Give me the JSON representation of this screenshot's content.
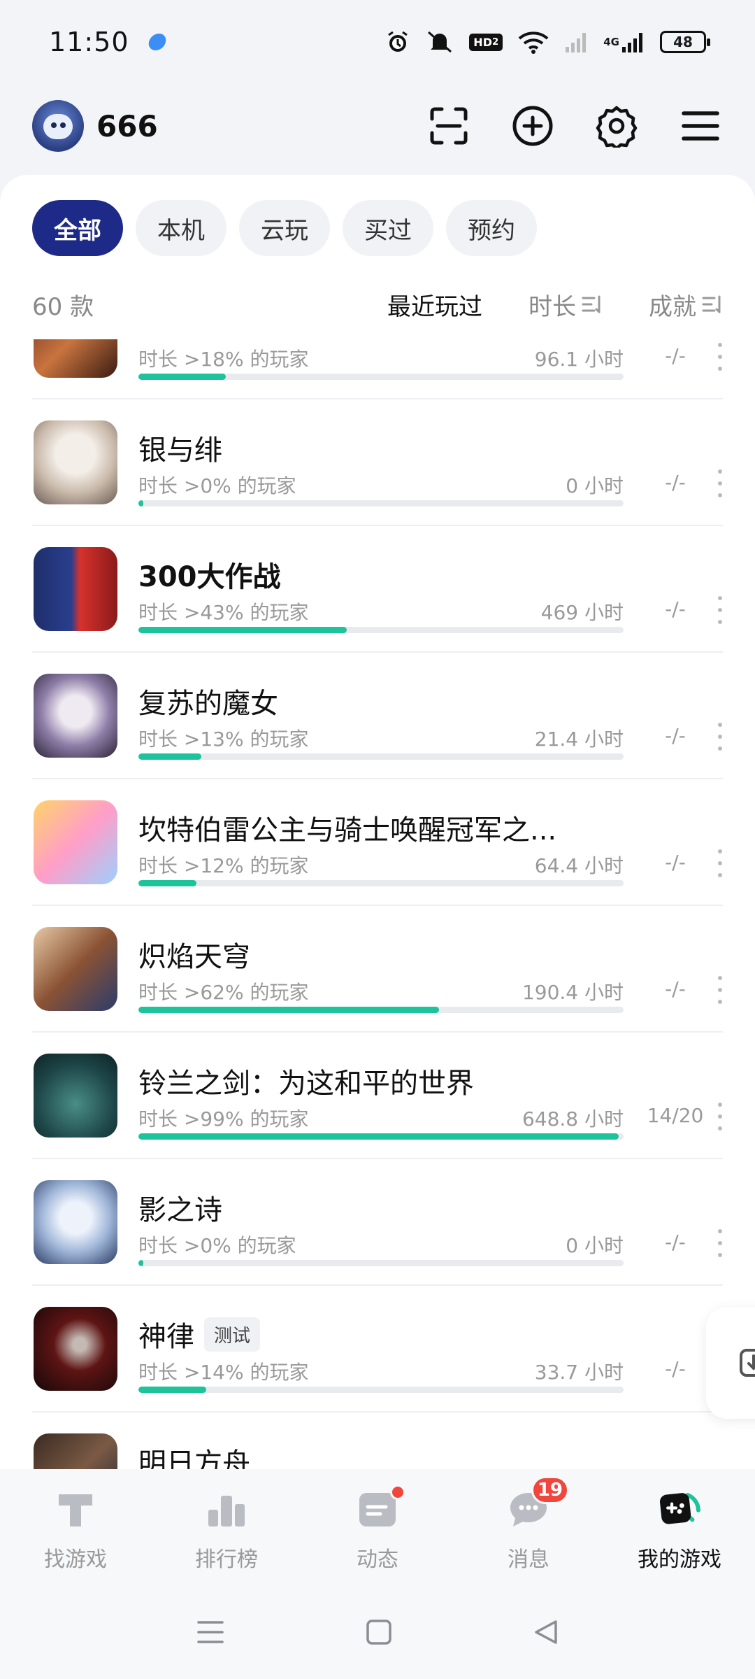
{
  "status": {
    "time": "11:50",
    "network": "4G",
    "battery": "48"
  },
  "user": {
    "name": "666"
  },
  "filters": [
    {
      "label": "全部",
      "active": true
    },
    {
      "label": "本机",
      "active": false
    },
    {
      "label": "云玩",
      "active": false
    },
    {
      "label": "买过",
      "active": false
    },
    {
      "label": "预约",
      "active": false
    }
  ],
  "sort": {
    "count": "60 款",
    "recent": "最近玩过",
    "duration": "时长",
    "achievement": "成就"
  },
  "games": [
    {
      "title": "",
      "pct_text": "时长 >18% 的玩家",
      "hours": "96.1 小时",
      "achv": "-/-",
      "progress": 0.18
    },
    {
      "title": "银与绯",
      "pct_text": "时长 >0% 的玩家",
      "hours": "0 小时",
      "achv": "-/-",
      "progress": 0.01
    },
    {
      "title": "300大作战",
      "pct_text": "时长 >43% 的玩家",
      "hours": "469 小时",
      "achv": "-/-",
      "progress": 0.43
    },
    {
      "title": "复苏的魔女",
      "pct_text": "时长 >13% 的玩家",
      "hours": "21.4 小时",
      "achv": "-/-",
      "progress": 0.13
    },
    {
      "title": "坎特伯雷公主与骑士唤醒冠军之...",
      "pct_text": "时长 >12% 的玩家",
      "hours": "64.4 小时",
      "achv": "-/-",
      "progress": 0.12
    },
    {
      "title": "炽焰天穹",
      "pct_text": "时长 >62% 的玩家",
      "hours": "190.4 小时",
      "achv": "-/-",
      "progress": 0.62
    },
    {
      "title": "铃兰之剑：为这和平的世界",
      "pct_text": "时长 >99% 的玩家",
      "hours": "648.8 小时",
      "achv": "14/20",
      "progress": 0.99
    },
    {
      "title": "影之诗",
      "pct_text": "时长 >0% 的玩家",
      "hours": "0 小时",
      "achv": "-/-",
      "progress": 0.01
    },
    {
      "title": "神律",
      "tag": "测试",
      "pct_text": "时长 >14% 的玩家",
      "hours": "33.7 小时",
      "achv": "-/-",
      "progress": 0.14
    },
    {
      "title": "明日方舟",
      "pct_text": "",
      "hours": "",
      "achv": "",
      "progress": 0
    }
  ],
  "nav": [
    {
      "label": "找游戏"
    },
    {
      "label": "排行榜"
    },
    {
      "label": "动态"
    },
    {
      "label": "消息",
      "badge": "19"
    },
    {
      "label": "我的游戏"
    }
  ],
  "colors": {
    "accent": "#1e2a87",
    "progress": "#1cc39b",
    "badge": "#f0463c"
  }
}
